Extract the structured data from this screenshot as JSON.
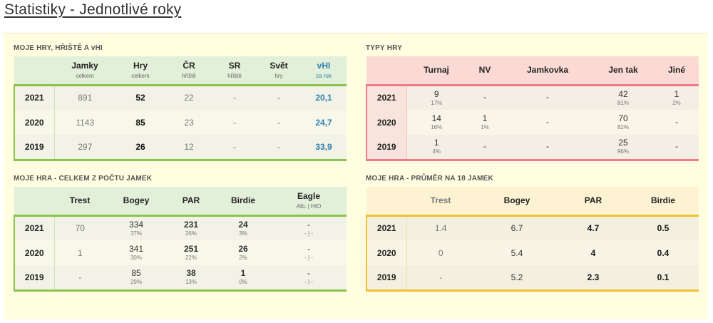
{
  "page_title": "Statistiky - Jednotlivé roky",
  "sections": {
    "moje_hry": {
      "title": "MOJE HRY, HŘIŠTĚ A vHI",
      "headers": [
        {
          "label": "",
          "sub": ""
        },
        {
          "label": "Jamky",
          "sub": "celkem"
        },
        {
          "label": "Hry",
          "sub": "celkem"
        },
        {
          "label": "ČR",
          "sub": "hřiště"
        },
        {
          "label": "SR",
          "sub": "hřiště"
        },
        {
          "label": "Svět",
          "sub": "hry"
        },
        {
          "label": "vHI",
          "sub": "za rok"
        }
      ],
      "rows": [
        {
          "year": "2021",
          "jamky": "891",
          "hry": "52",
          "cr": "22",
          "sr": "-",
          "svet": "-",
          "vhi": "20,1"
        },
        {
          "year": "2020",
          "jamky": "1143",
          "hry": "85",
          "cr": "23",
          "sr": "-",
          "svet": "-",
          "vhi": "24,7"
        },
        {
          "year": "2019",
          "jamky": "297",
          "hry": "26",
          "cr": "12",
          "sr": "-",
          "svet": "-",
          "vhi": "33,9"
        }
      ]
    },
    "typy_hry": {
      "title": "TYPY HRY",
      "headers": [
        "",
        "Turnaj",
        "NV",
        "Jamkovka",
        "Jen tak",
        "Jiné"
      ],
      "rows": [
        {
          "year": "2021",
          "turnaj": {
            "v": "9",
            "p": "17%"
          },
          "nv": {
            "v": "-",
            "p": ""
          },
          "jamkovka": {
            "v": "-",
            "p": ""
          },
          "jentak": {
            "v": "42",
            "p": "81%"
          },
          "jine": {
            "v": "1",
            "p": "2%"
          }
        },
        {
          "year": "2020",
          "turnaj": {
            "v": "14",
            "p": "16%"
          },
          "nv": {
            "v": "1",
            "p": "1%"
          },
          "jamkovka": {
            "v": "-",
            "p": ""
          },
          "jentak": {
            "v": "70",
            "p": "82%"
          },
          "jine": {
            "v": "-",
            "p": ""
          }
        },
        {
          "year": "2019",
          "turnaj": {
            "v": "1",
            "p": "4%"
          },
          "nv": {
            "v": "-",
            "p": ""
          },
          "jamkovka": {
            "v": "-",
            "p": ""
          },
          "jentak": {
            "v": "25",
            "p": "96%"
          },
          "jine": {
            "v": "-",
            "p": ""
          }
        }
      ]
    },
    "celkem": {
      "title": "MOJE HRA - CELKEM Z POČTU JAMEK",
      "headers": [
        {
          "label": "",
          "sub": ""
        },
        {
          "label": "Trest",
          "sub": ""
        },
        {
          "label": "Bogey",
          "sub": ""
        },
        {
          "label": "PAR",
          "sub": ""
        },
        {
          "label": "Birdie",
          "sub": ""
        },
        {
          "label": "Eagle",
          "sub": "Alb. | HIO"
        }
      ],
      "rows": [
        {
          "year": "2021",
          "trest": "70",
          "bogey": {
            "v": "334",
            "p": "37%"
          },
          "par": {
            "v": "231",
            "p": "26%"
          },
          "birdie": {
            "v": "24",
            "p": "3%"
          },
          "eagle": {
            "v": "-",
            "p": "- | -"
          }
        },
        {
          "year": "2020",
          "trest": "1",
          "bogey": {
            "v": "341",
            "p": "30%"
          },
          "par": {
            "v": "251",
            "p": "22%"
          },
          "birdie": {
            "v": "26",
            "p": "2%"
          },
          "eagle": {
            "v": "-",
            "p": "- | -"
          }
        },
        {
          "year": "2019",
          "trest": "-",
          "bogey": {
            "v": "85",
            "p": "29%"
          },
          "par": {
            "v": "38",
            "p": "13%"
          },
          "birdie": {
            "v": "1",
            "p": "0%"
          },
          "eagle": {
            "v": "-",
            "p": "- | -"
          }
        }
      ]
    },
    "prumer": {
      "title": "MOJE HRA - PRŮMĚR NA 18 JAMEK",
      "headers": [
        "",
        "Trest",
        "Bogey",
        "PAR",
        "Birdie"
      ],
      "rows": [
        {
          "year": "2021",
          "trest": "1.4",
          "bogey": "6.7",
          "par": "4.7",
          "birdie": "0.5"
        },
        {
          "year": "2020",
          "trest": "0",
          "bogey": "5.4",
          "par": "4",
          "birdie": "0.4"
        },
        {
          "year": "2019",
          "trest": "-",
          "bogey": "5.2",
          "par": "2.3",
          "birdie": "0.1"
        }
      ]
    }
  },
  "colors": {
    "green_accent": "#8bc34a",
    "red_accent": "#f07c8a",
    "yellow_accent": "#f0c030",
    "vhi_blue": "#2d7fb0",
    "panel_bg": "#fffee0"
  }
}
